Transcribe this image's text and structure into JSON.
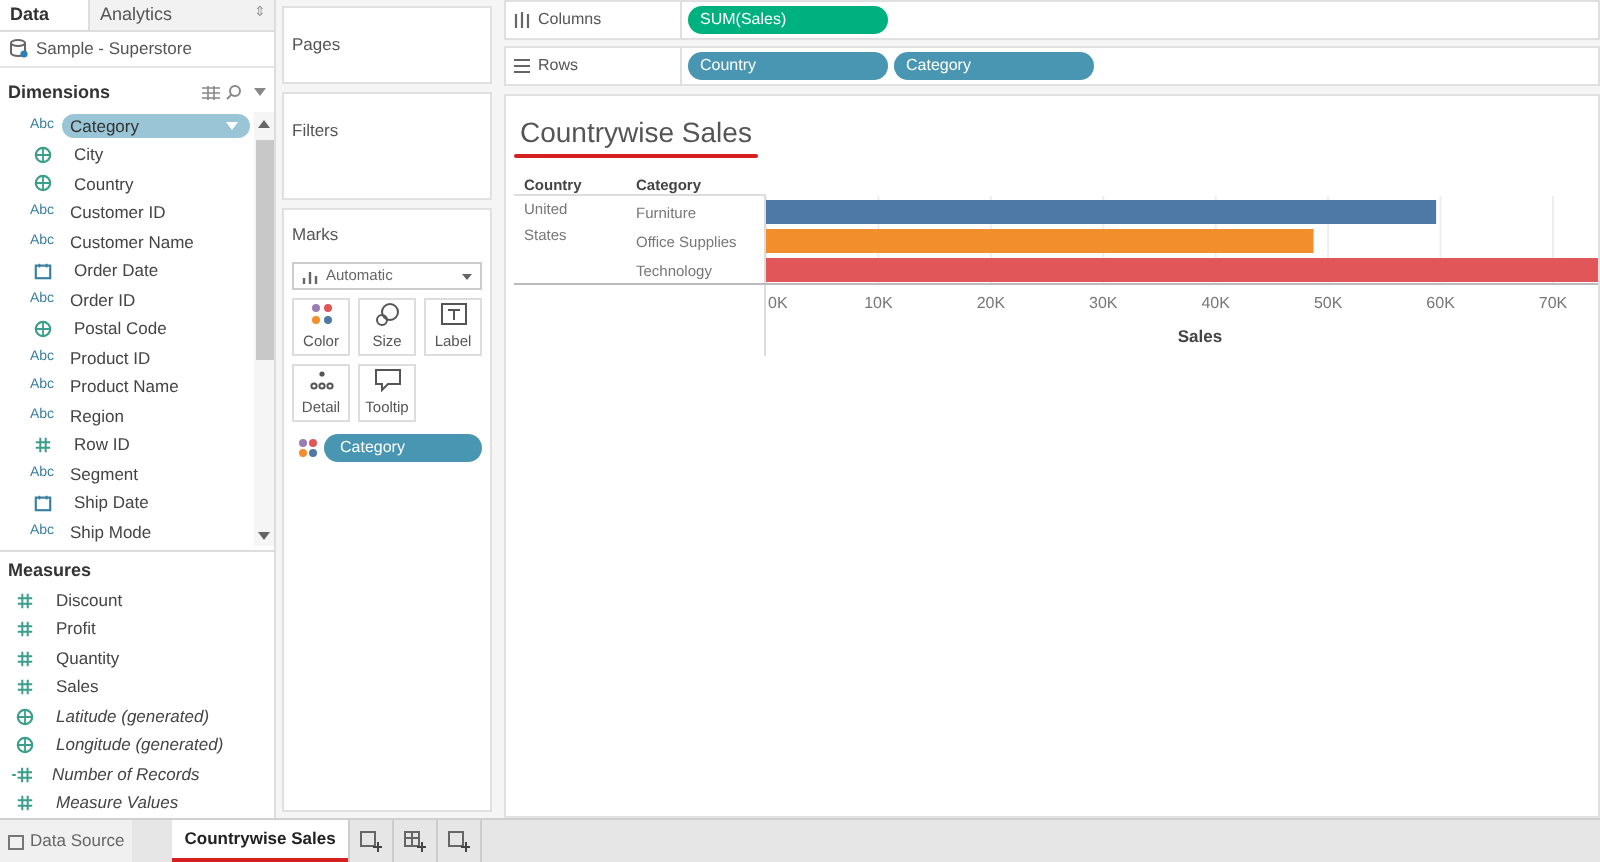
{
  "data_pane": {
    "tabs": [
      {
        "label": "Data",
        "selected": true
      },
      {
        "label": "Analytics",
        "selected": false
      }
    ],
    "tabs_menu": "⇕",
    "data_source": "Sample - Superstore",
    "dimensions": {
      "title": "Dimensions",
      "items": [
        {
          "label": "Category",
          "kind": "string",
          "type_text": "Abc",
          "selected": true
        },
        {
          "label": "City",
          "kind": "geo",
          "selected": false
        },
        {
          "label": "Country",
          "kind": "geo",
          "selected": false
        },
        {
          "label": "Customer ID",
          "kind": "string",
          "type_text": "Abc",
          "selected": false
        },
        {
          "label": "Customer Name",
          "kind": "string",
          "type_text": "Abc",
          "selected": false
        },
        {
          "label": "Order Date",
          "kind": "date",
          "selected": false
        },
        {
          "label": "Order ID",
          "kind": "string",
          "type_text": "Abc",
          "selected": false
        },
        {
          "label": "Postal Code",
          "kind": "geo",
          "selected": false
        },
        {
          "label": "Product ID",
          "kind": "string",
          "type_text": "Abc",
          "selected": false
        },
        {
          "label": "Product Name",
          "kind": "string",
          "type_text": "Abc",
          "selected": false
        },
        {
          "label": "Region",
          "kind": "string",
          "type_text": "Abc",
          "selected": false
        },
        {
          "label": "Row ID",
          "kind": "number",
          "selected": false
        },
        {
          "label": "Segment",
          "kind": "string",
          "type_text": "Abc",
          "selected": false
        },
        {
          "label": "Ship Date",
          "kind": "date",
          "selected": false
        },
        {
          "label": "Ship Mode",
          "kind": "string",
          "type_text": "Abc",
          "selected": false
        }
      ]
    },
    "measures": {
      "title": "Measures",
      "items": [
        {
          "label": "Discount",
          "kind": "number",
          "generated": false
        },
        {
          "label": "Profit",
          "kind": "number",
          "generated": false
        },
        {
          "label": "Quantity",
          "kind": "number",
          "generated": false
        },
        {
          "label": "Sales",
          "kind": "number",
          "generated": false
        },
        {
          "label": "Latitude (generated)",
          "kind": "geo",
          "generated": true
        },
        {
          "label": "Longitude (generated)",
          "kind": "geo",
          "generated": true
        },
        {
          "label": "Number of Records",
          "kind": "calc",
          "generated": true
        },
        {
          "label": "Measure Values",
          "kind": "number",
          "generated": true
        }
      ]
    }
  },
  "cards": {
    "pages": "Pages",
    "filters": "Filters",
    "marks": {
      "title": "Marks",
      "mark_type": "Automatic",
      "buttons": [
        {
          "label": "Color",
          "kind": "color"
        },
        {
          "label": "Size",
          "kind": "size"
        },
        {
          "label": "Label",
          "kind": "label"
        },
        {
          "label": "Detail",
          "kind": "detail"
        },
        {
          "label": "Tooltip",
          "kind": "tooltip"
        }
      ],
      "pill": "Category"
    }
  },
  "shelves": [
    {
      "label": "Columns",
      "kind": "columns",
      "pills": [
        {
          "label": "SUM(Sales)",
          "kind": "measure"
        }
      ]
    },
    {
      "label": "Rows",
      "kind": "rows",
      "pills": [
        {
          "label": "Country",
          "kind": "dimension"
        },
        {
          "label": "Category",
          "kind": "dimension"
        }
      ]
    }
  ],
  "view": {
    "title": "Countrywise Sales",
    "headers": [
      "Country",
      "Category"
    ],
    "country": "United States",
    "chart_data": {
      "type": "bar",
      "orientation": "horizontal",
      "xlabel": "Sales",
      "categories": [
        "Furniture",
        "Office Supplies",
        "Technology"
      ],
      "series": [
        {
          "values": [
            59600,
            48700,
            74000
          ]
        }
      ],
      "colors": [
        "#4e79a7",
        "#f28e2b",
        "#e15759"
      ],
      "grid": true,
      "xlim": [
        0,
        74000
      ],
      "xticks": [
        {
          "value": 0,
          "label": "0K"
        },
        {
          "value": 10000,
          "label": "10K"
        },
        {
          "value": 20000,
          "label": "20K"
        },
        {
          "value": 30000,
          "label": "30K"
        },
        {
          "value": 40000,
          "label": "40K"
        },
        {
          "value": 50000,
          "label": "50K"
        },
        {
          "value": 60000,
          "label": "60K"
        },
        {
          "value": 70000,
          "label": "70K"
        }
      ]
    }
  },
  "sheet_tabs": [
    {
      "label": "Data Source",
      "kind": "datasource",
      "selected": false
    },
    {
      "label": "Countrywise Sales",
      "kind": "sheet",
      "selected": true
    }
  ]
}
